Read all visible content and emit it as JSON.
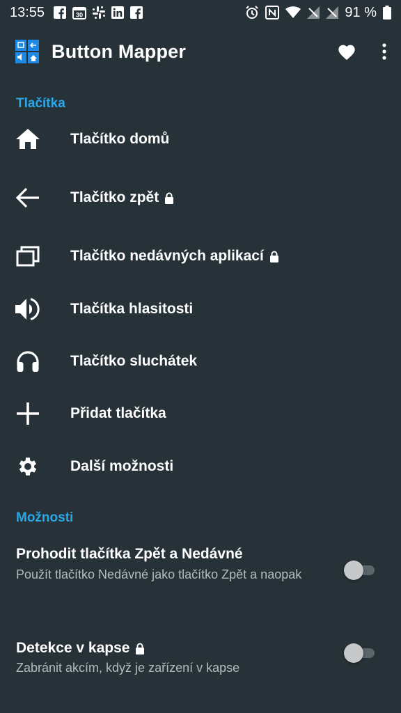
{
  "status_bar": {
    "time": "13:55",
    "left_icons": [
      "facebook-icon",
      "calendar-icon",
      "slack-icon",
      "linkedin-icon",
      "facebook-icon"
    ],
    "calendar_day": "30",
    "right_icons": [
      "alarm-icon",
      "nfc-icon",
      "wifi-icon",
      "no-signal-icon",
      "no-signal-icon"
    ],
    "battery": "91 %"
  },
  "app_bar": {
    "title": "Button Mapper",
    "actions": [
      "heart-icon",
      "more-vert-icon"
    ]
  },
  "sections": {
    "buttons_header": "Tlačítka",
    "options_header": "Možnosti"
  },
  "buttons": [
    {
      "label": "Tlačítko domů",
      "icon": "home-icon",
      "locked": false
    },
    {
      "label": "Tlačítko zpět",
      "icon": "back-arrow-icon",
      "locked": true
    },
    {
      "label": "Tlačítko nedávných aplikací",
      "icon": "recents-icon",
      "locked": true
    },
    {
      "label": "Tlačítka hlasitosti",
      "icon": "volume-icon",
      "locked": false
    },
    {
      "label": "Tlačítko sluchátek",
      "icon": "headphones-icon",
      "locked": false
    },
    {
      "label": "Přidat tlačítka",
      "icon": "plus-icon",
      "locked": false
    },
    {
      "label": "Další možnosti",
      "icon": "gear-icon",
      "locked": false
    }
  ],
  "options": [
    {
      "title": "Prohodit tlačítka Zpět a Nedávné",
      "subtitle": "Použít tlačítko Nedávné jako tlačítko Zpět a naopak",
      "locked": false,
      "enabled": false
    },
    {
      "title": "Detekce v kapse",
      "subtitle": "Zabránit akcím, když je zařízení v kapse",
      "locked": true,
      "enabled": false
    }
  ],
  "colors": {
    "background": "#263238",
    "accent": "#29a8e8",
    "subtitle": "#b4bcc0"
  }
}
